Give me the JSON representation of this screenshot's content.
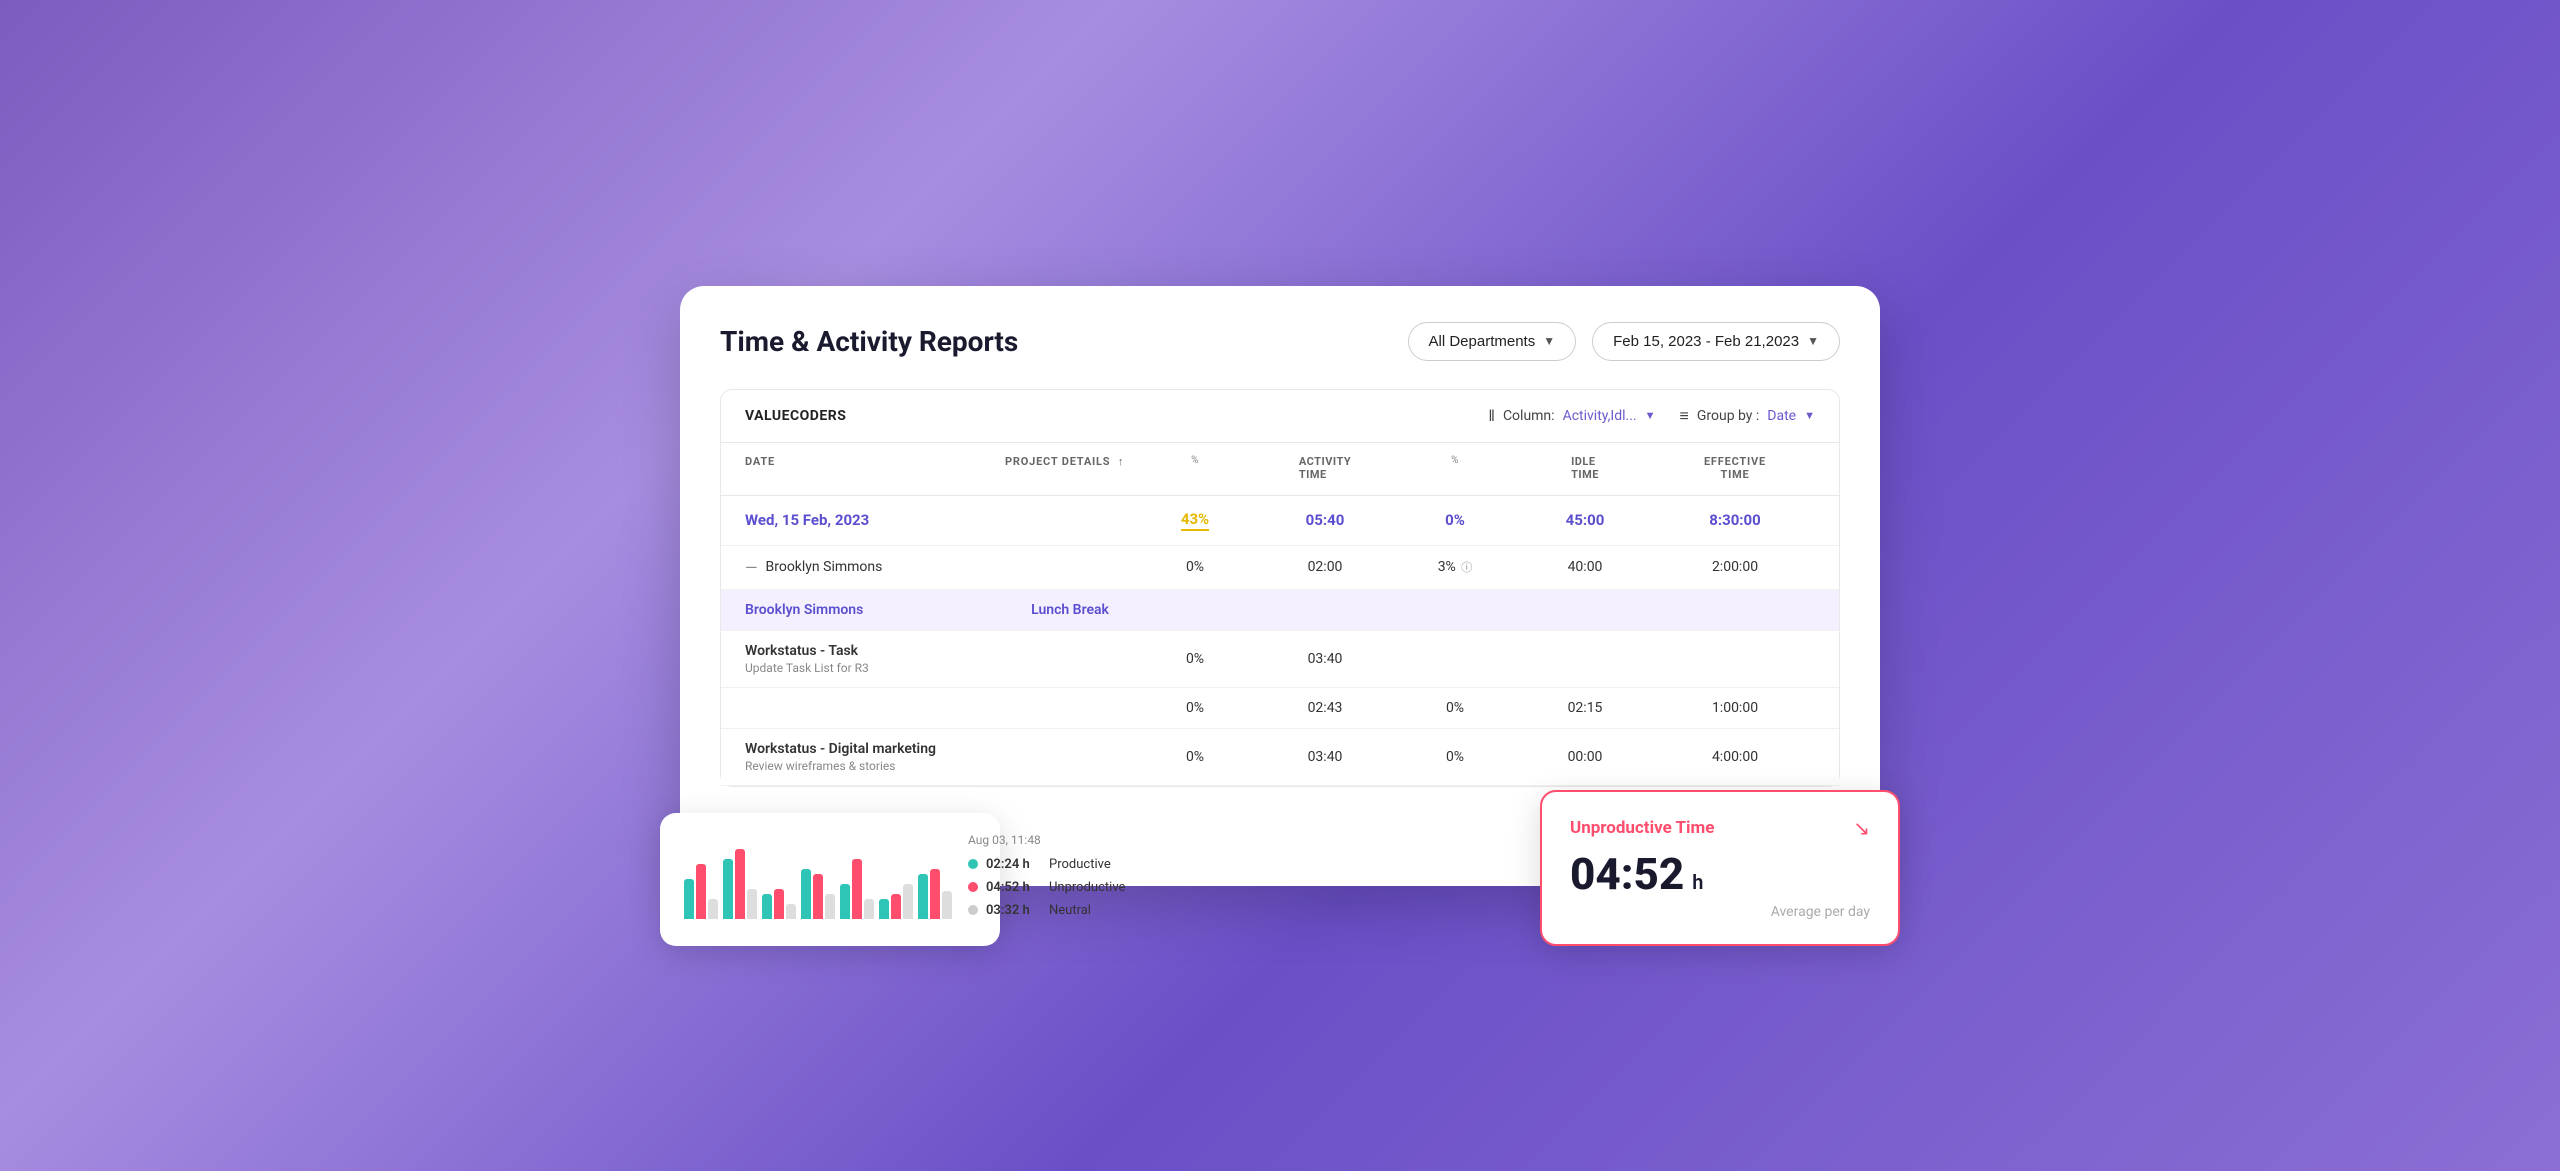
{
  "page": {
    "title": "Time & Activity Reports"
  },
  "header": {
    "departments_label": "All Departments",
    "date_range_label": "Feb 15, 2023 - Feb 21,2023"
  },
  "toolbar": {
    "company_name": "VALUECODERS",
    "column_label": "Column:",
    "column_value": "Activity,Idl...",
    "groupby_label": "Group by :",
    "groupby_value": "Date"
  },
  "table": {
    "columns": {
      "date": "DATE",
      "project": "PROJECT DETAILS",
      "activity_pct": "%",
      "activity_time": "ACTIVITY TIME",
      "idle_pct": "%",
      "idle_time": "IDLE TIME",
      "effective_time": "EFFECTIVE TIME"
    },
    "rows": [
      {
        "type": "date_group",
        "date": "Wed, 15 Feb, 2023",
        "activity_pct": "43%",
        "activity_time": "05:40",
        "idle_pct": "0%",
        "idle_time": "45:00",
        "effective_time": "8:30:00"
      },
      {
        "type": "person",
        "name": "Brooklyn Simmons",
        "activity_pct": "0%",
        "activity_time": "02:00",
        "idle_pct": "3%",
        "idle_time": "40:00",
        "effective_time": "2:00:00"
      },
      {
        "type": "project_highlight",
        "person": "Brooklyn Simmons",
        "task": "Lunch Break"
      },
      {
        "type": "project",
        "name": "Workstatus - Task",
        "subtask": "Update Task List for R3",
        "activity_pct": "0%",
        "activity_time": "03:40",
        "idle_pct": "",
        "idle_time": "",
        "effective_time": ""
      },
      {
        "type": "project",
        "name": "",
        "subtask": "",
        "activity_pct": "0%",
        "activity_time": "02:43",
        "idle_pct": "0%",
        "idle_time": "02:15",
        "effective_time": "1:00:00"
      },
      {
        "type": "project",
        "name": "Workstatus - Digital marketing",
        "subtask": "Review wireframes & stories",
        "activity_pct": "0%",
        "activity_time": "03:40",
        "idle_pct": "0%",
        "idle_time": "00:00",
        "effective_time": "4:00:00"
      }
    ]
  },
  "chart": {
    "timestamp": "Aug 03, 11:48",
    "legend": [
      {
        "color": "#2ec4b6",
        "value": "02:24 h",
        "label": "Productive"
      },
      {
        "color": "#ff4d6d",
        "value": "04:52 h",
        "label": "Unproductive"
      },
      {
        "color": "#ccc",
        "value": "03:32 h",
        "label": "Neutral"
      }
    ],
    "bars": [
      {
        "productive": 40,
        "unproductive": 55,
        "neutral": 20
      },
      {
        "productive": 60,
        "unproductive": 70,
        "neutral": 30
      },
      {
        "productive": 25,
        "unproductive": 30,
        "neutral": 15
      },
      {
        "productive": 50,
        "unproductive": 45,
        "neutral": 25
      },
      {
        "productive": 35,
        "unproductive": 60,
        "neutral": 20
      },
      {
        "productive": 20,
        "unproductive": 25,
        "neutral": 35
      },
      {
        "productive": 45,
        "unproductive": 50,
        "neutral": 28
      }
    ]
  },
  "unproductive_card": {
    "title": "Unproductive Time",
    "value": "04:52",
    "unit": "h",
    "avg_label": "Average  per day"
  }
}
